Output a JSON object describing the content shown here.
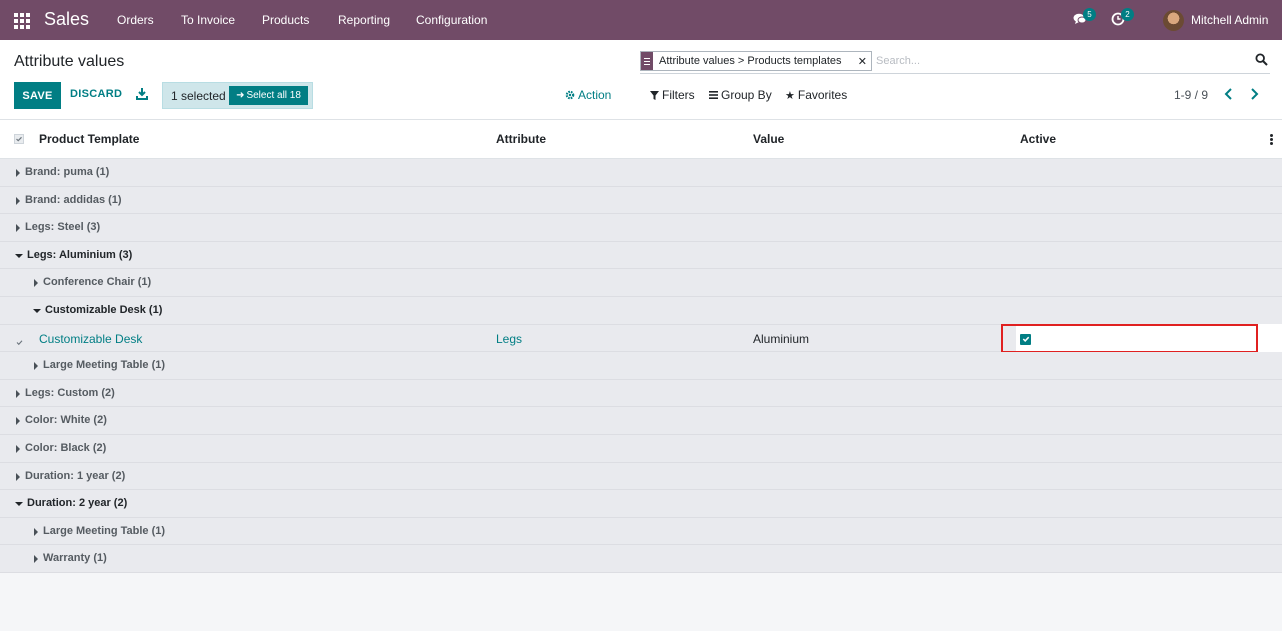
{
  "navbar": {
    "app_name": "Sales",
    "menu": [
      "Orders",
      "To Invoice",
      "Products",
      "Reporting",
      "Configuration"
    ],
    "messages_count": "5",
    "activities_count": "2",
    "user_name": "Mitchell Admin"
  },
  "control_panel": {
    "title": "Attribute values",
    "save_label": "SAVE",
    "discard_label": "DISCARD",
    "selected_label": "1 selected",
    "select_all_label": "Select all 18",
    "action_label": "Action",
    "search_facet": "Attribute values > Products templates",
    "search_placeholder": "Search...",
    "filters_label": "Filters",
    "group_by_label": "Group By",
    "favorites_label": "Favorites",
    "pager": "1-9 / 9"
  },
  "list": {
    "columns": [
      "Product Template",
      "Attribute",
      "Value",
      "Active"
    ],
    "groups": [
      {
        "label": "Brand: puma (1)",
        "level": 0,
        "open": false
      },
      {
        "label": "Brand: addidas (1)",
        "level": 0,
        "open": false
      },
      {
        "label": "Legs: Steel (3)",
        "level": 0,
        "open": false
      },
      {
        "label": "Legs: Aluminium (3)",
        "level": 0,
        "open": true
      },
      {
        "label": "Conference Chair (1)",
        "level": 1,
        "open": false
      },
      {
        "label": "Customizable Desk (1)",
        "level": 1,
        "open": true
      },
      {
        "label": "Large Meeting Table (1)",
        "level": 1,
        "open": false
      },
      {
        "label": "Legs: Custom (2)",
        "level": 0,
        "open": false
      },
      {
        "label": "Color: White (2)",
        "level": 0,
        "open": false
      },
      {
        "label": "Color: Black (2)",
        "level": 0,
        "open": false
      },
      {
        "label": "Duration: 1 year (2)",
        "level": 0,
        "open": false
      },
      {
        "label": "Duration: 2 year (2)",
        "level": 0,
        "open": true
      },
      {
        "label": "Large Meeting Table (1)",
        "level": 1,
        "open": false
      },
      {
        "label": "Warranty (1)",
        "level": 1,
        "open": false
      }
    ],
    "record": {
      "product_template": "Customizable Desk",
      "attribute": "Legs",
      "value": "Aluminium",
      "active": true
    }
  },
  "colors": {
    "brand": "#714b67",
    "accent": "#017e84",
    "highlight": "#e02020"
  }
}
